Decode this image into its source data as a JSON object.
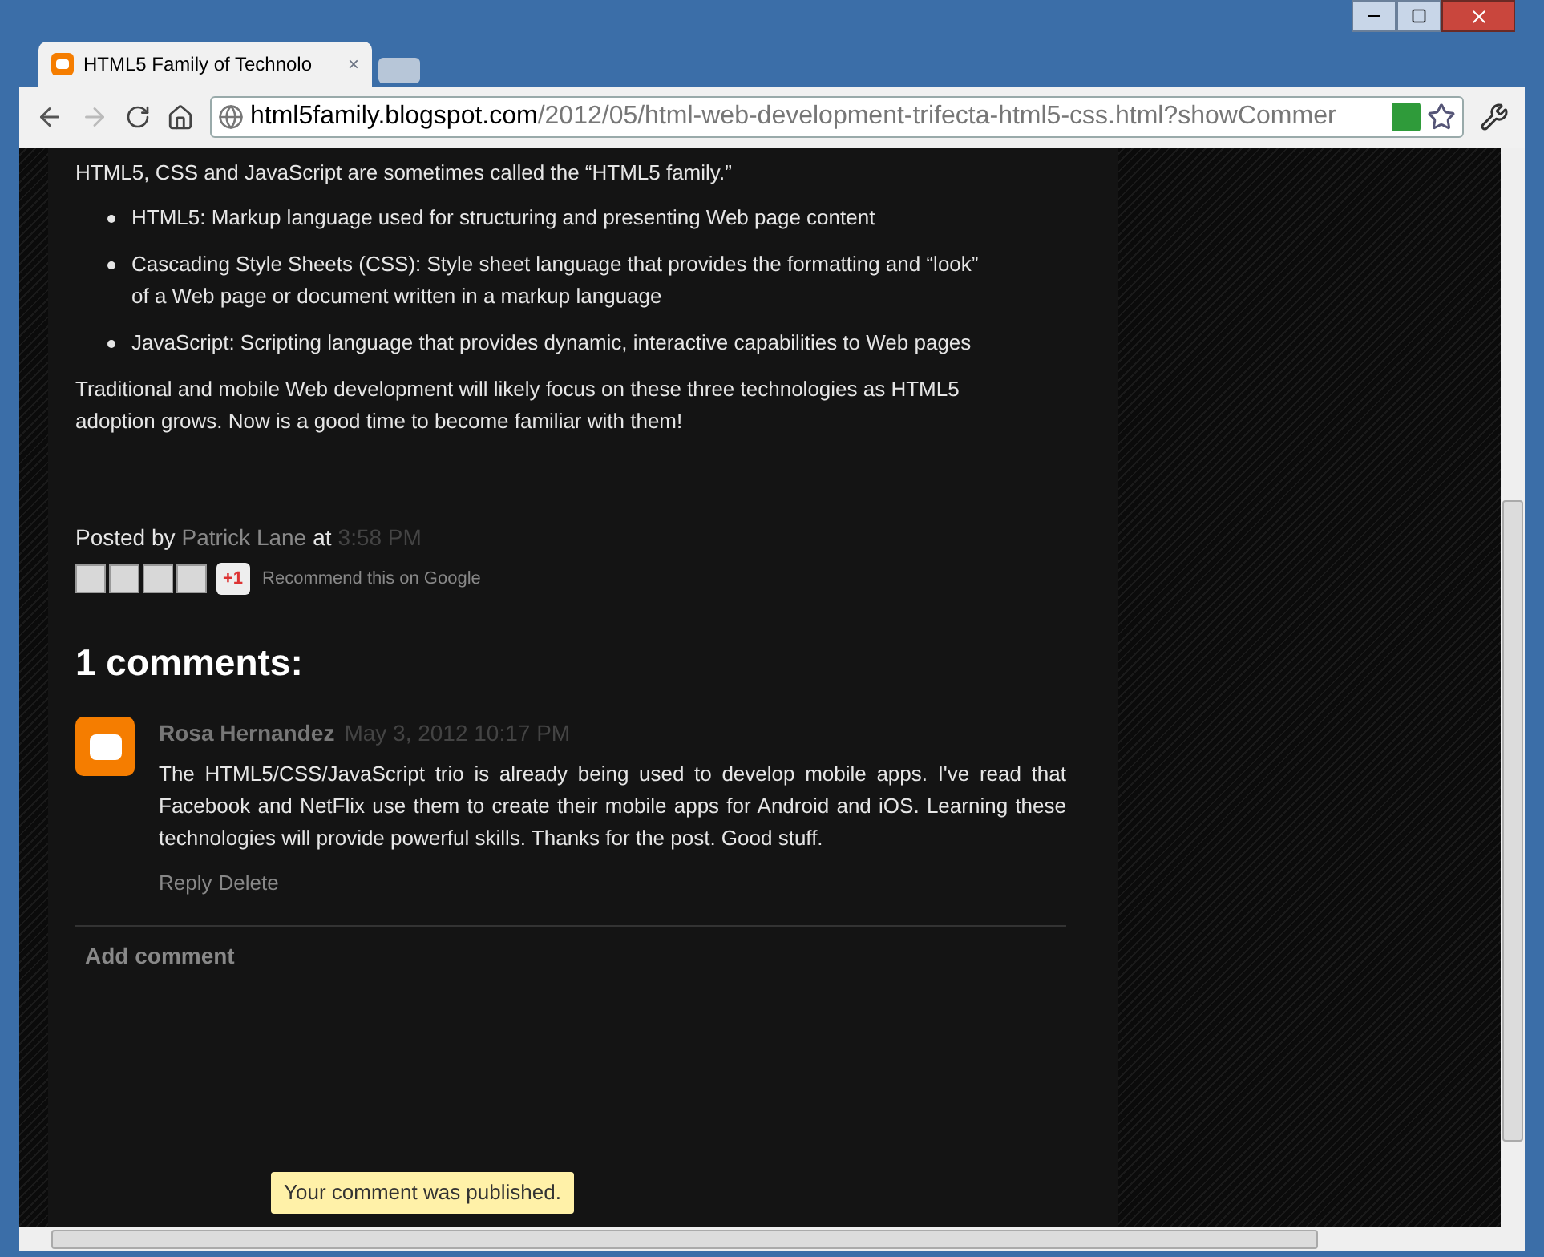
{
  "tab": {
    "title": "HTML5 Family of Technolo",
    "close": "×"
  },
  "address": {
    "host": "html5family.blogspot.com",
    "path": "/2012/05/html-web-development-trifecta-html5-css.html?showCommer"
  },
  "post": {
    "intro": "HTML5, CSS and JavaScript are sometimes called the “HTML5 family.”",
    "bullets": [
      "HTML5: Markup language used for structuring and presenting Web page content",
      "Cascading Style Sheets (CSS):  Style sheet language that provides the formatting and “look” of a Web page or document written in a markup language",
      "JavaScript:  Scripting language that provides dynamic, interactive capabilities to Web pages"
    ],
    "closing": "Traditional and mobile Web development will likely focus on these three technologies as HTML5 adoption grows. Now is a good time to become familiar with them!",
    "posted_by": "Posted by",
    "author": "Patrick Lane",
    "at": "at",
    "time": "3:58 PM",
    "plusone": "+1",
    "recommend": "Recommend this on Google"
  },
  "comments": {
    "heading": "1 comments:",
    "items": [
      {
        "author": "Rosa Hernandez",
        "date": "May 3, 2012 10:17 PM",
        "text": "The HTML5/CSS/JavaScript trio is already being used to develop mobile apps. I've read that Facebook and NetFlix use them to create their mobile apps for Android and iOS. Learning these technologies will provide powerful skills. Thanks for the post. Good stuff.",
        "actions": [
          "Reply",
          "Delete"
        ]
      }
    ],
    "add": "Add comment"
  },
  "toast": "Your comment was published."
}
